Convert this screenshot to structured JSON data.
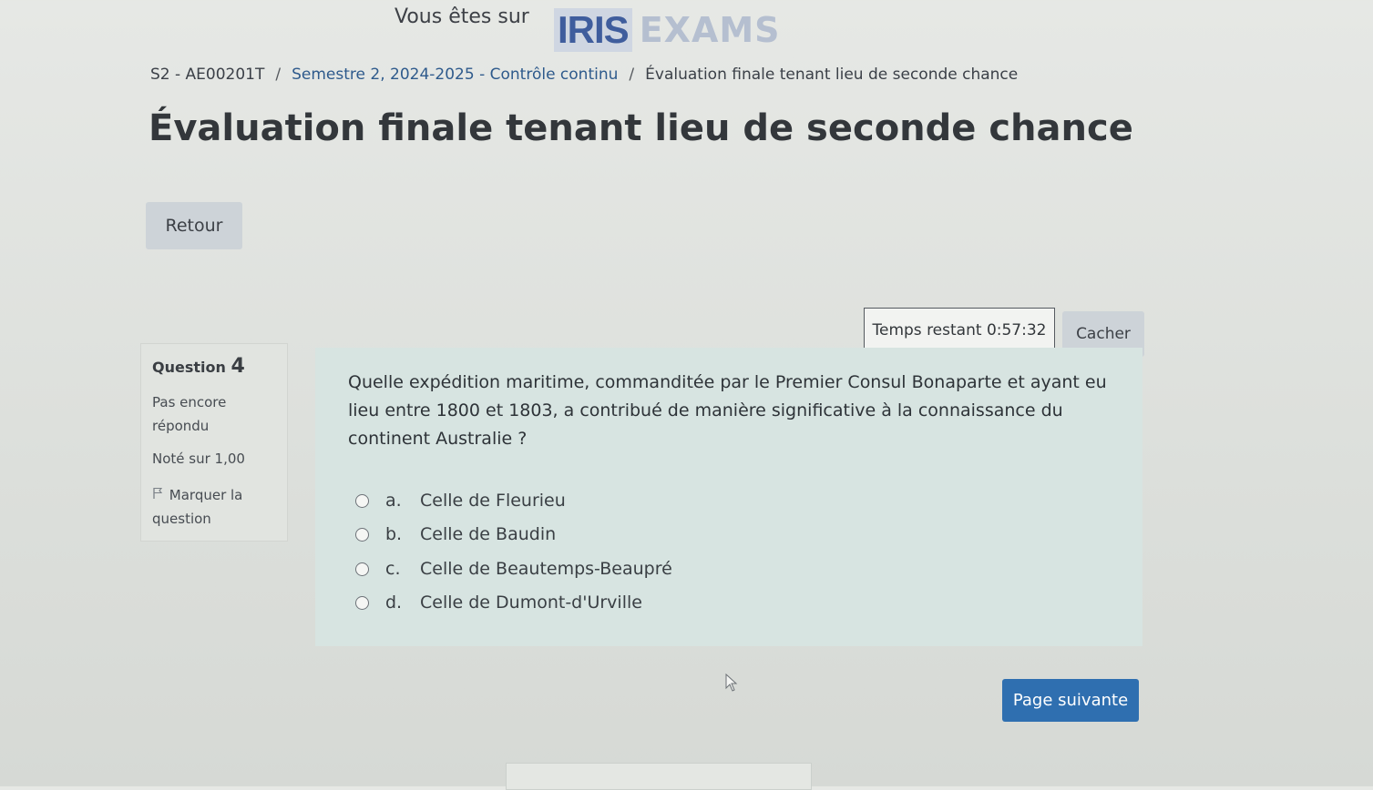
{
  "header": {
    "prefix": "Vous êtes sur",
    "logo_iris": "IRIS",
    "logo_exams": "EXAMS"
  },
  "breadcrumb": {
    "items": [
      "S2 - AE00201T",
      "Semestre 2, 2024-2025 - Contrôle continu",
      "Évaluation finale tenant lieu de seconde chance"
    ],
    "separator": "/"
  },
  "page": {
    "title": "Évaluation finale tenant lieu de seconde chance",
    "back_label": "Retour"
  },
  "timer": {
    "label": "Temps restant",
    "value": "0:57:32",
    "hide_label": "Cacher"
  },
  "question_info": {
    "label": "Question",
    "number": "4",
    "state": "Pas encore répondu",
    "grade": "Noté sur 1,00",
    "flag_label": "Marquer la question"
  },
  "question": {
    "text": "Quelle expédition maritime, commanditée par le Premier Consul Bonaparte et ayant eu lieu entre 1800 et 1803, a contribué de manière significative à la connaissance du continent Australie ?",
    "answers": [
      {
        "letter": "a.",
        "text": "Celle de Fleurieu",
        "selected": false
      },
      {
        "letter": "b.",
        "text": "Celle de Baudin",
        "selected": false
      },
      {
        "letter": "c.",
        "text": "Celle de Beautemps-Beaupré",
        "selected": false
      },
      {
        "letter": "d.",
        "text": "Celle de Dumont-d'Urville",
        "selected": false
      }
    ]
  },
  "navigation": {
    "next_label": "Page suivante"
  }
}
